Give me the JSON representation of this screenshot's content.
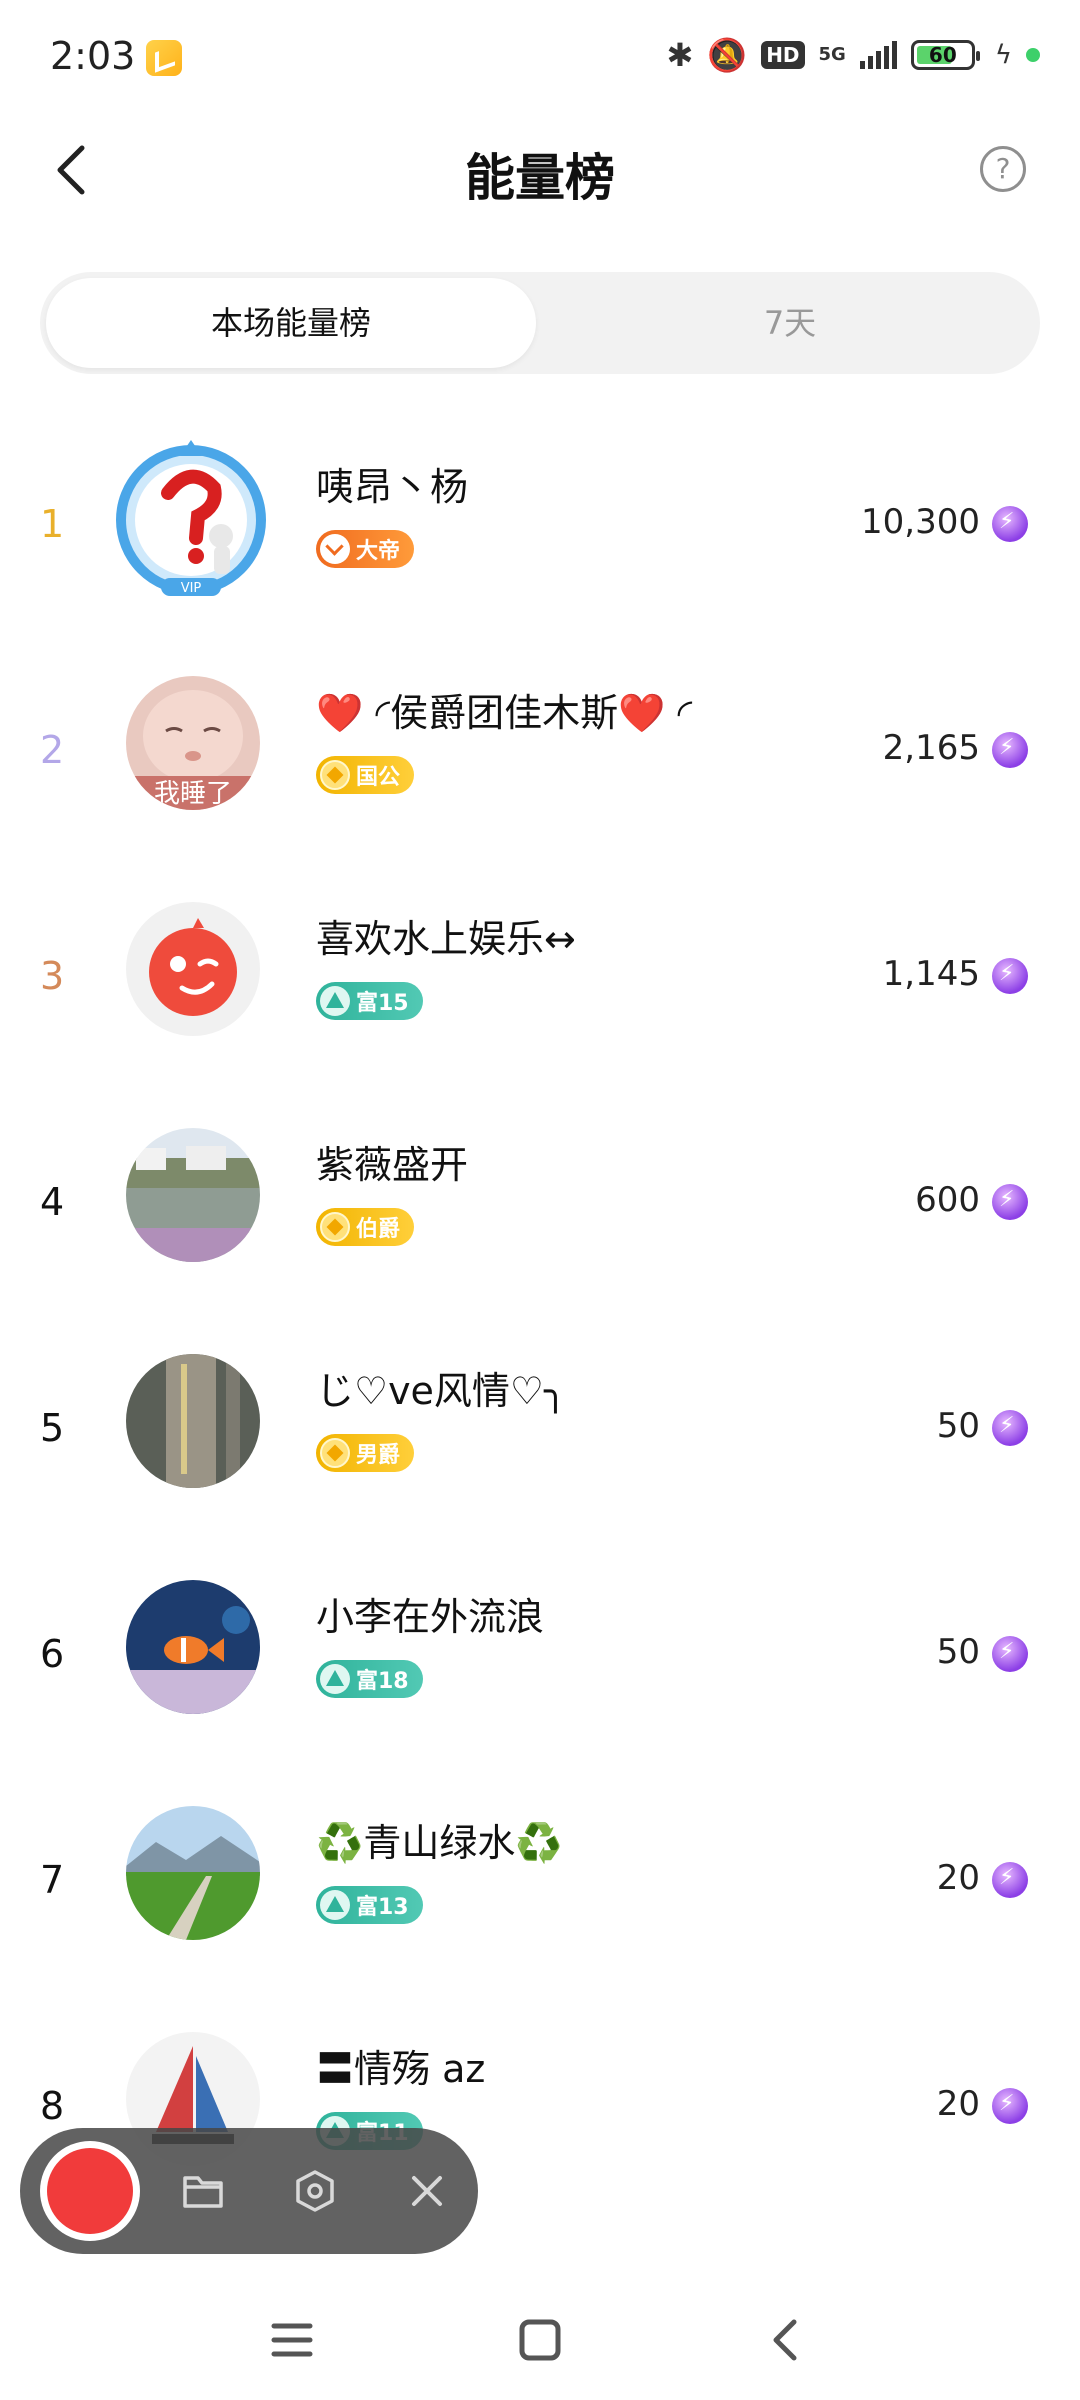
{
  "status_bar": {
    "time": "2:03",
    "network": "5G",
    "hd": "HD",
    "battery": "60"
  },
  "header": {
    "title": "能量榜",
    "help": "?"
  },
  "tabs": [
    {
      "label": "本场能量榜",
      "active": true
    },
    {
      "label": "7天",
      "active": false
    }
  ],
  "ranking": [
    {
      "rank": "1",
      "name": "咦昂丶杨",
      "badge": "大帝",
      "badge_style": "orange",
      "score": "10,300",
      "avatar": "vip-question-avatar"
    },
    {
      "rank": "2",
      "name": "❤️ ◜侯爵团佳木斯❤️ ◜",
      "badge": "国公",
      "badge_style": "gold",
      "score": "2,165",
      "avatar": "sleeping-baby-avatar"
    },
    {
      "rank": "3",
      "name": "喜欢水上娱乐↔",
      "badge": "富15",
      "badge_style": "teal",
      "score": "1,145",
      "avatar": "wink-face-avatar"
    },
    {
      "rank": "4",
      "name": "紫薇盛开",
      "badge": "伯爵",
      "badge_style": "gold",
      "score": "600",
      "avatar": "village-lake-avatar"
    },
    {
      "rank": "5",
      "name": "じ♡ve风情♡╮",
      "badge": "男爵",
      "badge_style": "gold",
      "score": "50",
      "avatar": "tree-trunk-avatar"
    },
    {
      "rank": "6",
      "name": "小李在外流浪",
      "badge": "富18",
      "badge_style": "teal",
      "score": "50",
      "avatar": "aquarium-fish-avatar"
    },
    {
      "rank": "7",
      "name": "♻️青山绿水♻️",
      "badge": "富13",
      "badge_style": "teal",
      "score": "20",
      "avatar": "green-field-avatar"
    },
    {
      "rank": "8",
      "name": "〓情殇 az",
      "badge": "富11",
      "badge_style": "teal",
      "score": "20",
      "avatar": "sailboat-avatar"
    }
  ],
  "colors": {
    "rank1": "#e9b02b",
    "rank2": "#b3a7e8",
    "rank3": "#d48a5a",
    "energy_icon": "#8c3fe6"
  }
}
